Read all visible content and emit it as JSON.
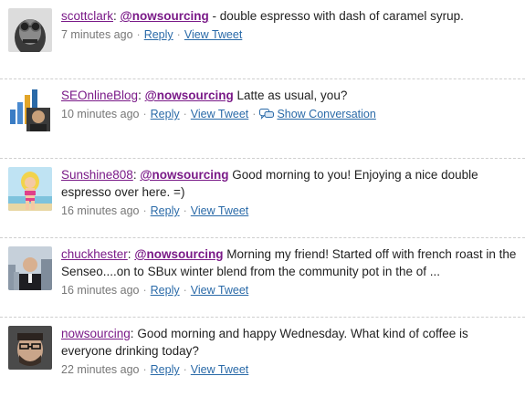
{
  "tweets": [
    {
      "user": "scottclark",
      "mention": "@nowsourcing",
      "text_before": ": ",
      "text_after": " - double espresso with dash of caramel syrup.",
      "time": "7 minutes ago",
      "reply": "Reply",
      "view": "View Tweet",
      "show_conversation": ""
    },
    {
      "user": "SEOnlineBlog",
      "mention": "@nowsourcing",
      "text_before": ": ",
      "text_after": " Latte as usual, you?",
      "time": "10 minutes ago",
      "reply": "Reply",
      "view": "View Tweet",
      "show_conversation": "Show Conversation"
    },
    {
      "user": "Sunshine808",
      "mention": "@nowsourcing",
      "text_before": ": ",
      "text_after": " Good morning to you! Enjoying a nice double espresso over here. =)",
      "time": "16 minutes ago",
      "reply": "Reply",
      "view": "View Tweet",
      "show_conversation": ""
    },
    {
      "user": "chuckhester",
      "mention": "@nowsourcing",
      "text_before": ": ",
      "text_after": " Morning my friend! Started off with french roast in the Senseo....on to SBux winter blend from the community pot in the of ...",
      "time": "16 minutes ago",
      "reply": "Reply",
      "view": "View Tweet",
      "show_conversation": ""
    },
    {
      "user": "nowsourcing",
      "mention": "",
      "text_before": ": ",
      "text_after": "Good morning and happy Wednesday. What kind of coffee is everyone drinking today?",
      "time": "22 minutes ago",
      "reply": "Reply",
      "view": "View Tweet",
      "show_conversation": ""
    }
  ],
  "separator": "·",
  "icons": {
    "conversation": "speech-bubbles-icon"
  },
  "colors": {
    "username": "#7a1a88",
    "link": "#2a6aa8",
    "meta": "#777777",
    "divider": "#cfcfcf"
  }
}
